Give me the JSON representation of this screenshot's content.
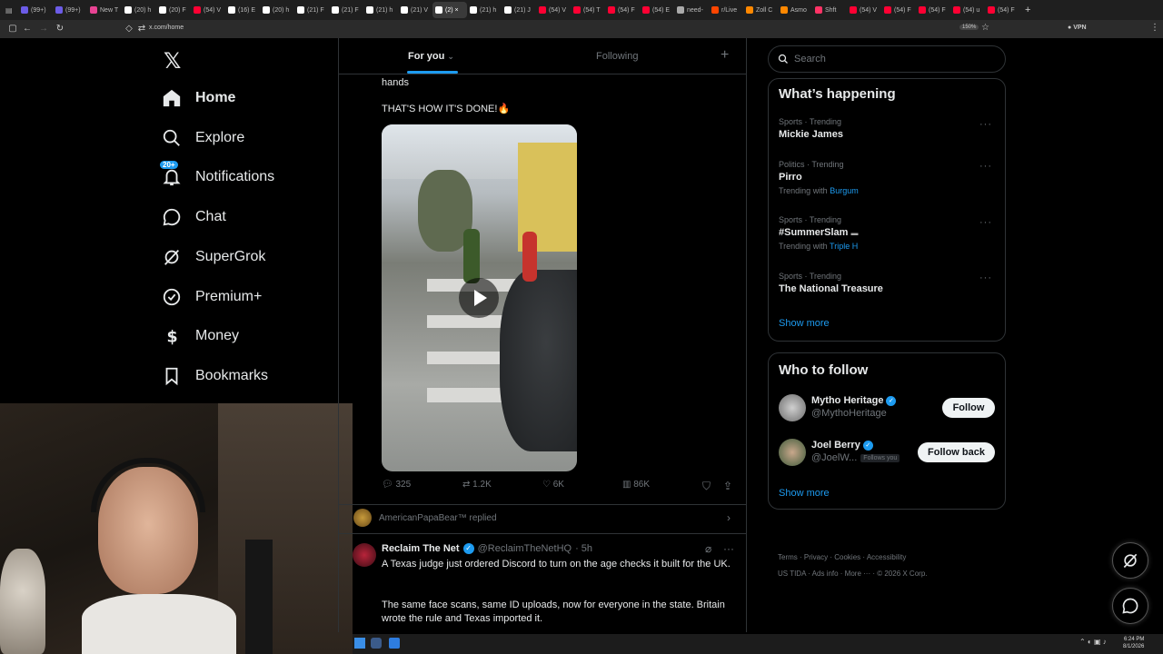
{
  "browser": {
    "tabs": [
      {
        "label": "(99+)",
        "color": "#6c5ce7"
      },
      {
        "label": "(99+)",
        "color": "#6c5ce7"
      },
      {
        "label": "New T",
        "color": "#e84393"
      },
      {
        "label": "(20) h",
        "color": "#ffffff"
      },
      {
        "label": "(20) F",
        "color": "#ffffff"
      },
      {
        "label": "(54) V",
        "color": "#ff0033"
      },
      {
        "label": "(16) E",
        "color": "#ffffff"
      },
      {
        "label": "(20) h",
        "color": "#ffffff"
      },
      {
        "label": "(21) F",
        "color": "#ffffff"
      },
      {
        "label": "(21) F",
        "color": "#ffffff"
      },
      {
        "label": "(21) h",
        "color": "#ffffff"
      },
      {
        "label": "(21) V",
        "color": "#ffffff"
      },
      {
        "label": "(2) ×",
        "color": "#ffffff",
        "active": true
      },
      {
        "label": "(21) h",
        "color": "#ffffff"
      },
      {
        "label": "(21) J",
        "color": "#ffffff"
      },
      {
        "label": "(54) V",
        "color": "#ff0033"
      },
      {
        "label": "(54) T",
        "color": "#ff0033"
      },
      {
        "label": "(54) F",
        "color": "#ff0033"
      },
      {
        "label": "(54) E",
        "color": "#ff0033"
      },
      {
        "label": "need-",
        "color": "#aaaaaa"
      },
      {
        "label": "r/Live",
        "color": "#ff4500"
      },
      {
        "label": "Zoll C",
        "color": "#ff8800"
      },
      {
        "label": "Asmo",
        "color": "#ff8800"
      },
      {
        "label": "Shft",
        "color": "#ff3366"
      },
      {
        "label": "(54) V",
        "color": "#ff0033"
      },
      {
        "label": "(54) F",
        "color": "#ff0033"
      },
      {
        "label": "(54) F",
        "color": "#ff0033"
      },
      {
        "label": "(54) u",
        "color": "#ff0033"
      },
      {
        "label": "(54) F",
        "color": "#ff0033"
      }
    ],
    "url": "x.com/home",
    "zoom": "150%",
    "vpn": "VPN"
  },
  "sidebar": {
    "items": [
      {
        "label": "Home",
        "icon": "home-icon",
        "bold": true
      },
      {
        "label": "Explore",
        "icon": "search-icon"
      },
      {
        "label": "Notifications",
        "icon": "bell-icon",
        "badge": "20+"
      },
      {
        "label": "Chat",
        "icon": "chat-icon"
      },
      {
        "label": "SuperGrok",
        "icon": "grok-icon"
      },
      {
        "label": "Premium+",
        "icon": "verified-icon"
      },
      {
        "label": "Money",
        "icon": "dollar-icon"
      },
      {
        "label": "Bookmarks",
        "icon": "bookmark-icon"
      }
    ]
  },
  "feed": {
    "tabs": [
      {
        "label": "For you",
        "active": true
      },
      {
        "label": "Following"
      }
    ],
    "post1": {
      "text_tail": "hands",
      "text_line": "THAT'S HOW IT'S DONE!🔥",
      "stats": {
        "replies": "325",
        "reposts": "1.2K",
        "likes": "6K",
        "views": "86K"
      }
    },
    "replied": "AmericanPapaBear™ replied",
    "post2": {
      "name": "Reclaim The Net",
      "handle": "@ReclaimTheNetHQ",
      "time": "· 5h",
      "para1": "A Texas judge just ordered Discord to turn on the age checks it built for the UK.",
      "para2": "The same face scans, same ID uploads, now for everyone in the state. Britain wrote the rule and Texas imported it."
    }
  },
  "right": {
    "search_placeholder": "Search",
    "happening_title": "What’s happening",
    "trends": [
      {
        "category": "Sports · Trending",
        "name": "Mickie James",
        "with": "",
        "with_link": ""
      },
      {
        "category": "Politics · Trending",
        "name": "Pirro",
        "with": "Trending with",
        "with_link": "Burgum"
      },
      {
        "category": "Sports · Trending",
        "name": "#SummerSlam",
        "with": "Trending with",
        "with_link": "Triple H"
      },
      {
        "category": "Sports · Trending",
        "name": "The National Treasure",
        "with": "",
        "with_link": ""
      }
    ],
    "show_more": "Show more",
    "who_title": "Who to follow",
    "follow": [
      {
        "name": "Mytho Heritage",
        "handle": "@MythoHeritage",
        "button": "Follow",
        "follows_you": ""
      },
      {
        "name": "Joel Berry",
        "handle": "@JoelW...",
        "button": "Follow back",
        "follows_you": "Follows you"
      }
    ],
    "show_more2": "Show more",
    "footer1": [
      "Terms",
      "Privacy",
      "Cookies",
      "Accessibility"
    ],
    "footer2": [
      "US TIDA",
      "Ads info",
      "More ···",
      "© 2026 X Corp."
    ]
  },
  "taskbar": {
    "time": "6:24 PM",
    "date": "8/1/2026"
  }
}
